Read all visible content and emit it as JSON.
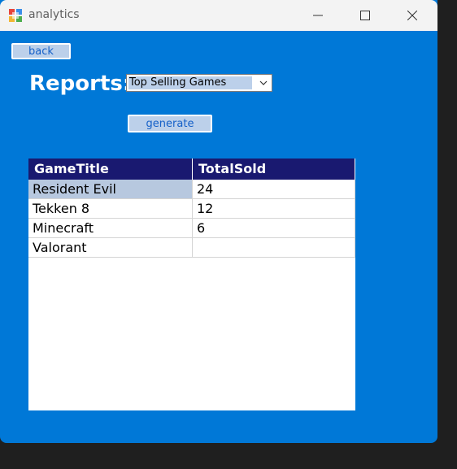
{
  "window": {
    "title": "analytics"
  },
  "toolbar": {
    "back_label": "back",
    "generate_label": "generate"
  },
  "reports": {
    "label": "Reports:",
    "selected_report": "Top Selling Games"
  },
  "grid": {
    "columns": [
      "GameTitle",
      "TotalSold"
    ],
    "rows": [
      [
        "Resident Evil",
        "24"
      ],
      [
        "Tekken 8",
        "12"
      ],
      [
        "Minecraft",
        "6"
      ],
      [
        "Valorant",
        ""
      ]
    ],
    "selected_cell": "Resident Evil"
  },
  "colors": {
    "window_background": "#0078d7",
    "header_background": "#191970",
    "button_fill": "#bcd0ea"
  }
}
